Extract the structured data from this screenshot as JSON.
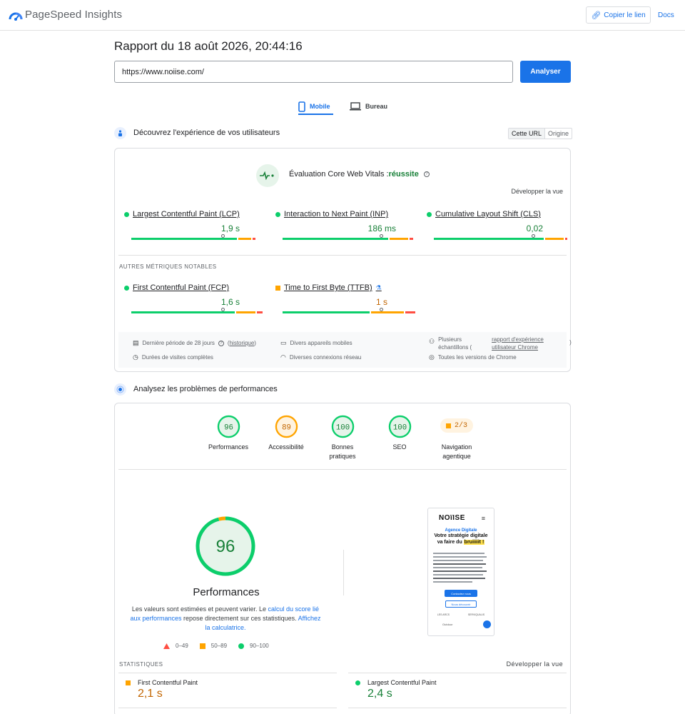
{
  "header": {
    "app_title": "PageSpeed Insights",
    "copy_link_label": "Copier le lien",
    "docs_label": "Docs"
  },
  "report": {
    "title": "Rapport du 18 août 2026, 20:44:16",
    "url_value": "https://www.noiise.com/",
    "analyze_label": "Analyser"
  },
  "device_tabs": {
    "mobile_label": "Mobile",
    "desktop_label": "Bureau",
    "active": "Mobile"
  },
  "cwv_section": {
    "title": "Découvrez l'expérience de vos utilisateurs",
    "toggle_this_url": "Cette URL",
    "toggle_origin": "Origine",
    "evaluation_prefix": "Évaluation Core Web Vitals :",
    "evaluation_result": "réussite",
    "expand_label": "Développer la vue",
    "metrics": [
      {
        "name": "Largest Contentful Paint (LCP)",
        "value": "1,9 s",
        "status": "good"
      },
      {
        "name": "Interaction to Next Paint (INP)",
        "value": "186 ms",
        "status": "good"
      },
      {
        "name": "Cumulative Layout Shift (CLS)",
        "value": "0,02",
        "status": "good"
      }
    ],
    "notable_label": "AUTRES MÉTRIQUES NOTABLES",
    "notable_metrics": [
      {
        "name": "First Contentful Paint (FCP)",
        "value": "1,6 s",
        "status": "good"
      },
      {
        "name": "Time to First Byte (TTFB)",
        "value": "1 s",
        "status": "average"
      }
    ],
    "info": {
      "period": "Dernière période de 28 jours",
      "history_link": "historique",
      "devices": "Divers appareils mobiles",
      "samples_prefix": "Plusieurs échantillons (",
      "samples_link": "rapport d'expérience utilisateur Chrome",
      "samples_suffix": ")",
      "durations": "Durées de visites complètes",
      "connections": "Diverses connexions réseau",
      "chrome_versions": "Toutes les versions de Chrome"
    }
  },
  "perf_section": {
    "title": "Analysez les problèmes de performances",
    "categories": [
      {
        "label": "Performances",
        "score": "96",
        "status": "good"
      },
      {
        "label": "Accessibilité",
        "score": "89",
        "status": "average"
      },
      {
        "label": "Bonnes pratiques",
        "score": "100",
        "status": "good"
      },
      {
        "label": "SEO",
        "score": "100",
        "status": "good"
      },
      {
        "label": "Navigation agentique",
        "score": "2/3",
        "status": "average"
      }
    ],
    "big_score": "96",
    "big_title": "Performances",
    "desc_1": "Les valeurs sont estimées et peuvent varier. Le ",
    "desc_link_1": "calcul du score lié aux performances",
    "desc_2": " repose directement sur ces statistiques. ",
    "desc_link_2": "Affichez la calculatrice.",
    "legend": [
      "0–49",
      "50–89",
      "90–100"
    ],
    "stats_label": "STATISTIQUES",
    "stats_expand": "Développer la vue",
    "stats": [
      {
        "name": "First Contentful Paint",
        "value": "2,1 s",
        "status": "average"
      },
      {
        "name": "Largest Contentful Paint",
        "value": "2,4 s",
        "status": "good"
      }
    ]
  },
  "preview": {
    "logo": "NOïISE",
    "kicker": "Agence Digitale",
    "headline_1": "Votre stratégie digitale",
    "headline_2": "va faire du",
    "highlight": "bruiiiiit !",
    "cta": "Contactez nous",
    "secondary": "Nous découvrir",
    "partner_1": "LES ARCS",
    "partner_2": "Outdoor",
    "partner_3": "SERVIQUALIS"
  },
  "colors": {
    "accent": "#1a73e8",
    "good": "#0cce6b",
    "good_text": "#188038",
    "average": "#ffa400",
    "average_text": "#c26500",
    "poor": "#ff4e42"
  }
}
